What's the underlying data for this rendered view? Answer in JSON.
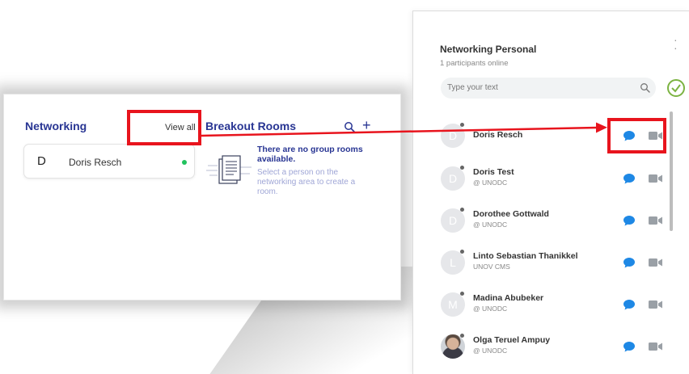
{
  "networking_panel": {
    "title": "Networking",
    "view_all_label": "View all",
    "person": {
      "initial": "D",
      "name": "Doris Resch"
    }
  },
  "breakout_rooms": {
    "title": "Breakout Rooms",
    "empty_title": "There are no group rooms available.",
    "empty_hint": "Select a person on the networking area to create a room."
  },
  "networking_personal": {
    "title": "Networking Personal",
    "online_count_label": "1 participants online",
    "search_placeholder": "Type your text",
    "participants": [
      {
        "initial": "D",
        "name": "Doris Resch",
        "org": ""
      },
      {
        "initial": "D",
        "name": "Doris Test",
        "org": "@ UNODC"
      },
      {
        "initial": "D",
        "name": "Dorothee Gottwald",
        "org": "@ UNODC"
      },
      {
        "initial": "L",
        "name": "Linto Sebastian Thanikkel",
        "org": "UNOV CMS"
      },
      {
        "initial": "M",
        "name": "Madina Abubeker",
        "org": "@ UNODC"
      },
      {
        "initial": "",
        "name": "Olga Teruel Ampuy",
        "org": "@ UNODC"
      }
    ]
  },
  "colors": {
    "brand_navy": "#283593",
    "highlight_red": "#e8141d",
    "online_green": "#21c25e",
    "chat_blue": "#1e88e5",
    "video_gray": "#9aa0a6"
  },
  "icons": [
    "search-icon",
    "plus-icon",
    "chat-icon",
    "video-icon",
    "check-circle-icon",
    "more-vertical-icon",
    "document-icon"
  ]
}
